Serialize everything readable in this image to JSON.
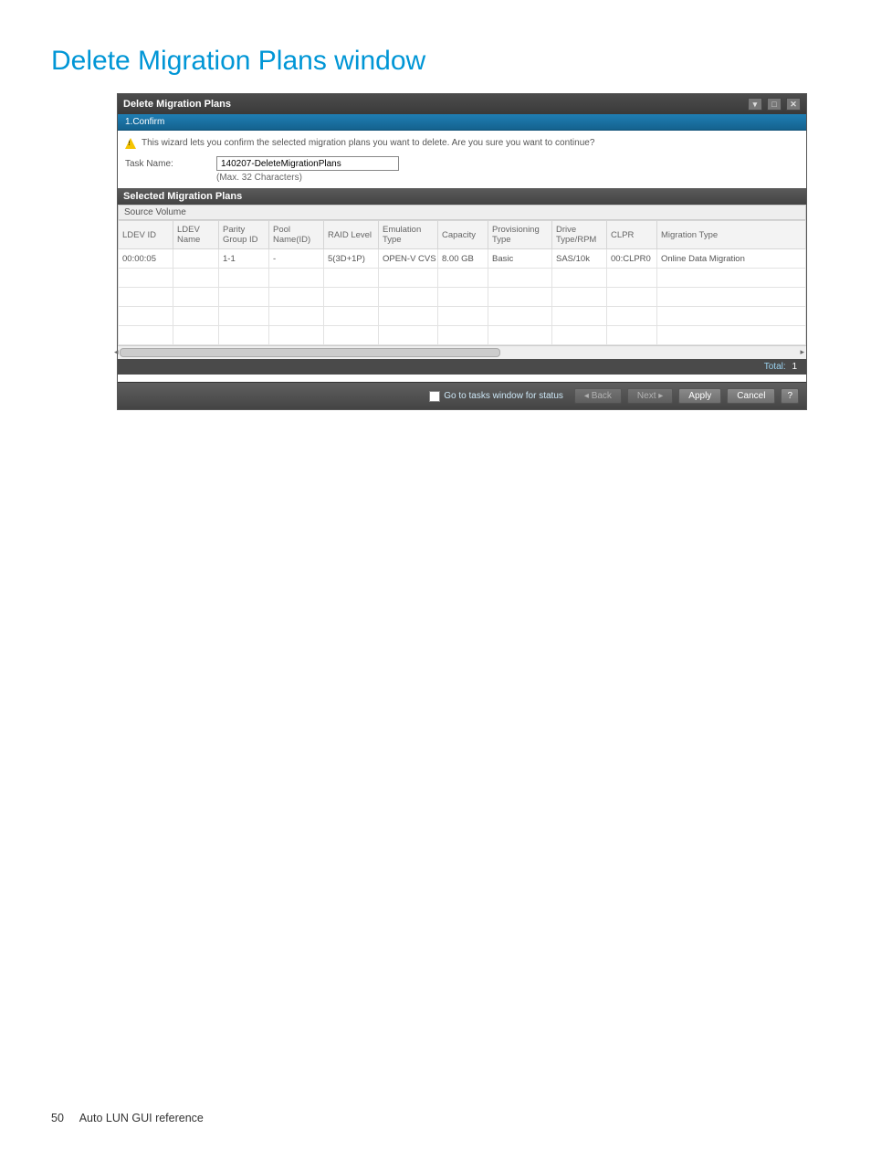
{
  "page": {
    "title": "Delete Migration Plans window",
    "footer_page": "50",
    "footer_text": "Auto LUN GUI reference"
  },
  "window": {
    "title": "Delete Migration Plans",
    "step": "1.Confirm",
    "message": "This wizard lets you confirm the selected migration plans you want to delete. Are you sure you want to continue?",
    "task_name_label": "Task Name:",
    "task_name_value": "140207-DeleteMigrationPlans",
    "task_name_hint": "(Max. 32 Characters)",
    "section_title": "Selected Migration Plans",
    "subheader": "Source Volume",
    "columns": [
      "LDEV ID",
      "LDEV Name",
      "Parity Group ID",
      "Pool Name(ID)",
      "RAID Level",
      "Emulation Type",
      "Capacity",
      "Provisioning Type",
      "Drive Type/RPM",
      "CLPR",
      "Migration Type"
    ],
    "rows": [
      {
        "ldev_id": "00:00:05",
        "ldev_name": "",
        "parity_group": "1-1",
        "pool": "-",
        "raid": "5(3D+1P)",
        "emulation": "OPEN-V CVS",
        "capacity": "8.00 GB",
        "provisioning": "Basic",
        "drive": "SAS/10k",
        "clpr": "00:CLPR0",
        "migration": "Online Data Migration"
      }
    ],
    "total_label": "Total:",
    "total_value": "1",
    "status_note": "Go to tasks window for status",
    "buttons": {
      "back": "◂ Back",
      "next": "Next ▸",
      "apply": "Apply",
      "cancel": "Cancel",
      "help": "?"
    }
  }
}
